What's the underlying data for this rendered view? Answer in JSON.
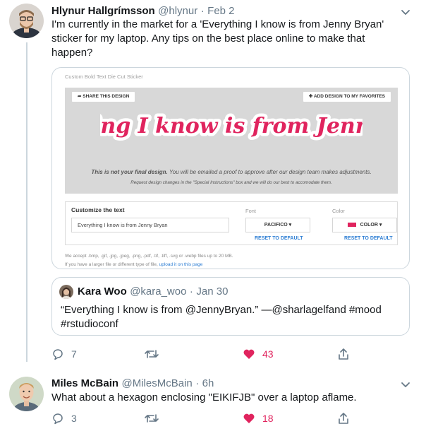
{
  "tweet1": {
    "name": "Hlynur Hallgrímsson",
    "handle": "@hlynur",
    "separator": "·",
    "date": "Feb 2",
    "text_line1": "I'm currently in the market for a 'Everything I know is from Jenny Bryan'",
    "text_line2": "sticker for my laptop. Any tips on the best place online to make that",
    "text_line3": "happen?",
    "card": {
      "title": "Custom Bold Text Die Cut Sticker",
      "share_label": "SHARE THIS DESIGN",
      "favorites_label": "ADD DESIGN TO MY FAVORITES",
      "sticker_text": "Everything I know is from Jenny Bryan",
      "disclaimer_bold": "This is not your final design.",
      "disclaimer_rest": " You will be emailed a proof to approve after our design team makes adjustments.",
      "request_text": "Request design changes in the \"Special Instructions\" box and we will do our best to accomodate them.",
      "customize_label": "Customize the text",
      "customize_value": "Everything I know is from Jenny Bryan",
      "font_label": "Font",
      "font_value": "PACIFICO ▾",
      "color_label": "Color",
      "color_value": "COLOR ▾",
      "reset_label": "RESET TO DEFAULT",
      "accept_line1": "We accept .bmp, .gif, .jpg, .jpeg, .png, .pdf, .tif, .tiff, .svg or .webp files up to 20 MB.",
      "accept_line2_prefix": "If you have a larger file or different type of file, ",
      "accept_link": "upload it on this page",
      "sticker_color": "#e0245e"
    },
    "quote": {
      "name": "Kara Woo",
      "handle": "@kara_woo",
      "separator": "·",
      "date": "Jan 30",
      "text_line1": "“Everything I know is from @JennyBryan.” —@sharlagelfand #mood",
      "text_line2": "#rstudioconf"
    },
    "actions": {
      "replies": "7",
      "retweets": "",
      "likes": "43"
    }
  },
  "tweet2": {
    "name": "Miles McBain",
    "handle": "@MilesMcBain",
    "separator": "·",
    "date": "6h",
    "text": "What about a hexagon enclosing \"EIKIFJB\" over a laptop aflame.",
    "actions": {
      "replies": "3",
      "retweets": "",
      "likes": "18"
    }
  },
  "colors": {
    "like": "#e0245e",
    "muted": "#657786",
    "link": "#2f7fd4"
  }
}
